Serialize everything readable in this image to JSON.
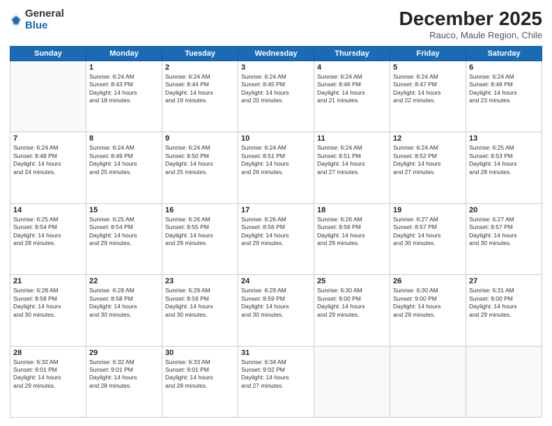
{
  "logo": {
    "general": "General",
    "blue": "Blue"
  },
  "header": {
    "month": "December 2025",
    "location": "Rauco, Maule Region, Chile"
  },
  "days_of_week": [
    "Sunday",
    "Monday",
    "Tuesday",
    "Wednesday",
    "Thursday",
    "Friday",
    "Saturday"
  ],
  "weeks": [
    [
      {
        "day": "",
        "info": ""
      },
      {
        "day": "1",
        "info": "Sunrise: 6:24 AM\nSunset: 8:43 PM\nDaylight: 14 hours\nand 18 minutes."
      },
      {
        "day": "2",
        "info": "Sunrise: 6:24 AM\nSunset: 8:44 PM\nDaylight: 14 hours\nand 19 minutes."
      },
      {
        "day": "3",
        "info": "Sunrise: 6:24 AM\nSunset: 8:45 PM\nDaylight: 14 hours\nand 20 minutes."
      },
      {
        "day": "4",
        "info": "Sunrise: 6:24 AM\nSunset: 8:46 PM\nDaylight: 14 hours\nand 21 minutes."
      },
      {
        "day": "5",
        "info": "Sunrise: 6:24 AM\nSunset: 8:47 PM\nDaylight: 14 hours\nand 22 minutes."
      },
      {
        "day": "6",
        "info": "Sunrise: 6:24 AM\nSunset: 8:48 PM\nDaylight: 14 hours\nand 23 minutes."
      }
    ],
    [
      {
        "day": "7",
        "info": "Sunrise: 6:24 AM\nSunset: 8:48 PM\nDaylight: 14 hours\nand 24 minutes."
      },
      {
        "day": "8",
        "info": "Sunrise: 6:24 AM\nSunset: 8:49 PM\nDaylight: 14 hours\nand 25 minutes."
      },
      {
        "day": "9",
        "info": "Sunrise: 6:24 AM\nSunset: 8:50 PM\nDaylight: 14 hours\nand 25 minutes."
      },
      {
        "day": "10",
        "info": "Sunrise: 6:24 AM\nSunset: 8:51 PM\nDaylight: 14 hours\nand 26 minutes."
      },
      {
        "day": "11",
        "info": "Sunrise: 6:24 AM\nSunset: 8:51 PM\nDaylight: 14 hours\nand 27 minutes."
      },
      {
        "day": "12",
        "info": "Sunrise: 6:24 AM\nSunset: 8:52 PM\nDaylight: 14 hours\nand 27 minutes."
      },
      {
        "day": "13",
        "info": "Sunrise: 6:25 AM\nSunset: 8:53 PM\nDaylight: 14 hours\nand 28 minutes."
      }
    ],
    [
      {
        "day": "14",
        "info": "Sunrise: 6:25 AM\nSunset: 8:54 PM\nDaylight: 14 hours\nand 28 minutes."
      },
      {
        "day": "15",
        "info": "Sunrise: 6:25 AM\nSunset: 8:54 PM\nDaylight: 14 hours\nand 29 minutes."
      },
      {
        "day": "16",
        "info": "Sunrise: 6:26 AM\nSunset: 8:55 PM\nDaylight: 14 hours\nand 29 minutes."
      },
      {
        "day": "17",
        "info": "Sunrise: 6:26 AM\nSunset: 8:56 PM\nDaylight: 14 hours\nand 29 minutes."
      },
      {
        "day": "18",
        "info": "Sunrise: 6:26 AM\nSunset: 8:56 PM\nDaylight: 14 hours\nand 29 minutes."
      },
      {
        "day": "19",
        "info": "Sunrise: 6:27 AM\nSunset: 8:57 PM\nDaylight: 14 hours\nand 30 minutes."
      },
      {
        "day": "20",
        "info": "Sunrise: 6:27 AM\nSunset: 8:57 PM\nDaylight: 14 hours\nand 30 minutes."
      }
    ],
    [
      {
        "day": "21",
        "info": "Sunrise: 6:28 AM\nSunset: 8:58 PM\nDaylight: 14 hours\nand 30 minutes."
      },
      {
        "day": "22",
        "info": "Sunrise: 6:28 AM\nSunset: 8:58 PM\nDaylight: 14 hours\nand 30 minutes."
      },
      {
        "day": "23",
        "info": "Sunrise: 6:29 AM\nSunset: 8:59 PM\nDaylight: 14 hours\nand 30 minutes."
      },
      {
        "day": "24",
        "info": "Sunrise: 6:29 AM\nSunset: 8:59 PM\nDaylight: 14 hours\nand 30 minutes."
      },
      {
        "day": "25",
        "info": "Sunrise: 6:30 AM\nSunset: 9:00 PM\nDaylight: 14 hours\nand 29 minutes."
      },
      {
        "day": "26",
        "info": "Sunrise: 6:30 AM\nSunset: 9:00 PM\nDaylight: 14 hours\nand 29 minutes."
      },
      {
        "day": "27",
        "info": "Sunrise: 6:31 AM\nSunset: 9:00 PM\nDaylight: 14 hours\nand 29 minutes."
      }
    ],
    [
      {
        "day": "28",
        "info": "Sunrise: 6:32 AM\nSunset: 9:01 PM\nDaylight: 14 hours\nand 29 minutes."
      },
      {
        "day": "29",
        "info": "Sunrise: 6:32 AM\nSunset: 9:01 PM\nDaylight: 14 hours\nand 28 minutes."
      },
      {
        "day": "30",
        "info": "Sunrise: 6:33 AM\nSunset: 9:01 PM\nDaylight: 14 hours\nand 28 minutes."
      },
      {
        "day": "31",
        "info": "Sunrise: 6:34 AM\nSunset: 9:02 PM\nDaylight: 14 hours\nand 27 minutes."
      },
      {
        "day": "",
        "info": ""
      },
      {
        "day": "",
        "info": ""
      },
      {
        "day": "",
        "info": ""
      }
    ]
  ]
}
